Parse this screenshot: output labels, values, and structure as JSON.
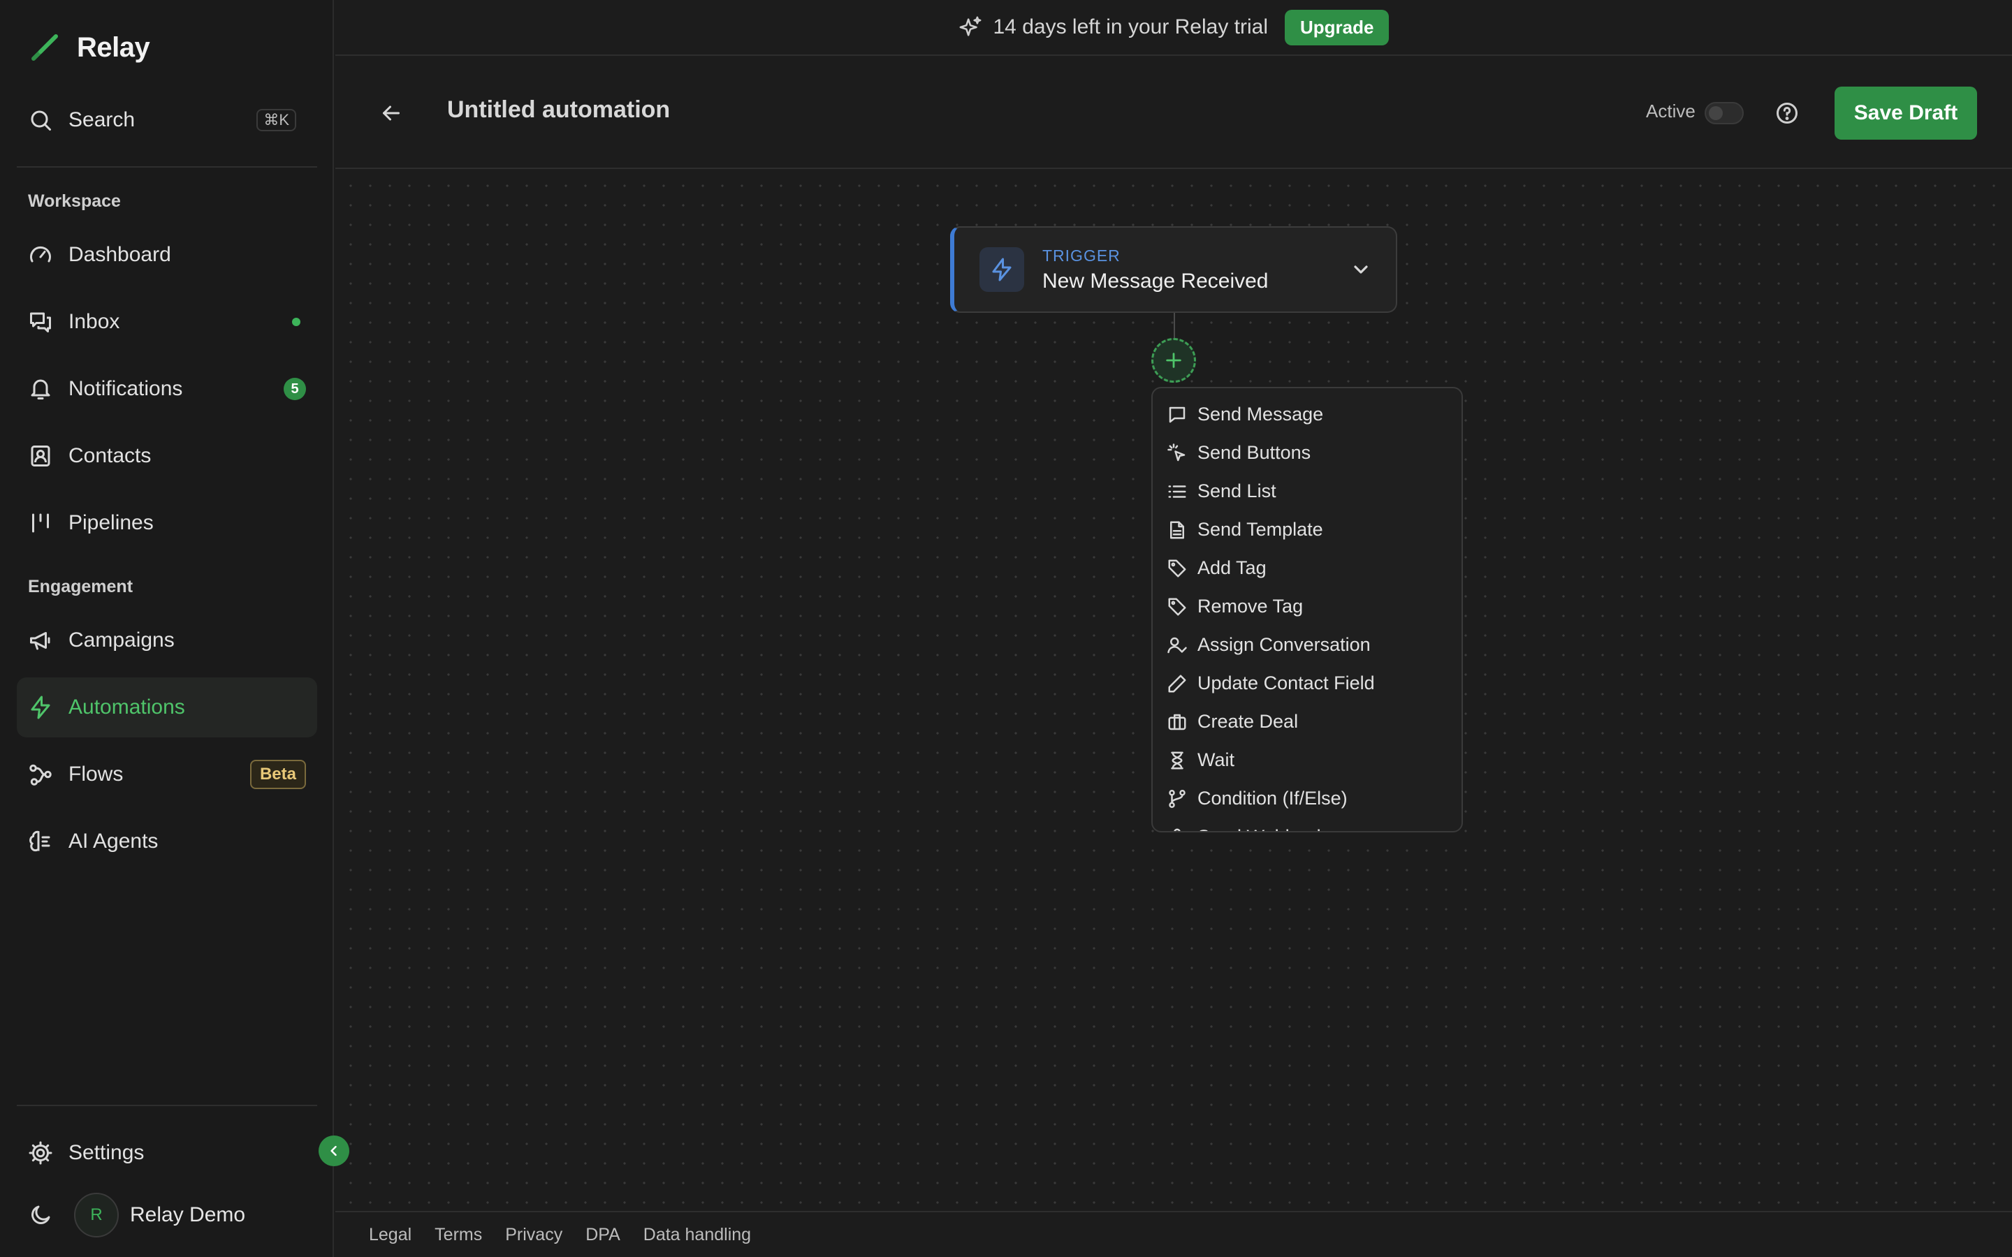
{
  "app": {
    "name": "Relay"
  },
  "sidebar": {
    "search": {
      "label": "Search",
      "shortcut": "⌘K",
      "icon": "search-icon"
    },
    "workspace_label": "Workspace",
    "engagement_label": "Engagement",
    "items": [
      {
        "label": "Dashboard",
        "icon": "gauge-icon"
      },
      {
        "label": "Inbox",
        "icon": "inbox-icon",
        "indicator": "dot"
      },
      {
        "label": "Notifications",
        "icon": "bell-icon",
        "badge": "5"
      },
      {
        "label": "Contacts",
        "icon": "contacts-icon"
      },
      {
        "label": "Pipelines",
        "icon": "pipelines-icon"
      },
      {
        "label": "Campaigns",
        "icon": "megaphone-icon"
      },
      {
        "label": "Automations",
        "icon": "bolt-icon",
        "active": true
      },
      {
        "label": "Flows",
        "icon": "flows-icon",
        "tag": "Beta"
      },
      {
        "label": "AI Agents",
        "icon": "brain-icon"
      }
    ],
    "settings_label": "Settings",
    "user": {
      "initial": "R",
      "name": "Relay Demo"
    }
  },
  "banner": {
    "text": "14 days left in your Relay trial",
    "button": "Upgrade"
  },
  "header": {
    "title": "Untitled automation",
    "active_label": "Active",
    "active_on": false,
    "save_label": "Save Draft"
  },
  "canvas": {
    "trigger": {
      "kind": "TRIGGER",
      "name": "New Message Received"
    },
    "menu": [
      {
        "label": "Send Message",
        "icon": "message-icon"
      },
      {
        "label": "Send Buttons",
        "icon": "click-icon"
      },
      {
        "label": "Send List",
        "icon": "list-icon"
      },
      {
        "label": "Send Template",
        "icon": "document-icon"
      },
      {
        "label": "Add Tag",
        "icon": "tag-icon"
      },
      {
        "label": "Remove Tag",
        "icon": "tag-icon"
      },
      {
        "label": "Assign Conversation",
        "icon": "user-check-icon"
      },
      {
        "label": "Update Contact Field",
        "icon": "pencil-icon"
      },
      {
        "label": "Create Deal",
        "icon": "briefcase-icon"
      },
      {
        "label": "Wait",
        "icon": "hourglass-icon"
      },
      {
        "label": "Condition (If/Else)",
        "icon": "branch-icon"
      },
      {
        "label": "Send Webhook",
        "icon": "webhook-icon"
      }
    ]
  },
  "footer": {
    "links": [
      "Legal",
      "Terms",
      "Privacy",
      "DPA",
      "Data handling"
    ]
  },
  "colors": {
    "accent": "#2f8f46",
    "accent_text": "#4fc46a",
    "trigger_accent": "#3e7bd4",
    "background": "#1c1c1c"
  }
}
